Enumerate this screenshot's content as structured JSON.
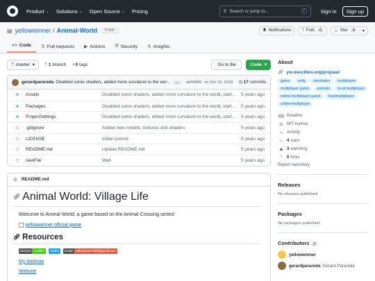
{
  "header": {
    "nav": [
      "Product",
      "Solutions",
      "Open Source",
      "Pricing"
    ],
    "search_placeholder": "Search or jump to...",
    "search_key": "/",
    "sign_in": "Sign in",
    "sign_up": "Sign up"
  },
  "repo": {
    "owner": "yellowwinner",
    "separator": "/",
    "name": "Animal-World",
    "visibility": "Public",
    "notifications_label": "Notifications",
    "fork_label": "Fork",
    "fork_count": "0",
    "star_label": "Star",
    "star_count": "4"
  },
  "tabs": [
    {
      "label": "Code",
      "icon": "code-icon"
    },
    {
      "label": "Pull requests",
      "icon": "pull-request-icon"
    },
    {
      "label": "Actions",
      "icon": "actions-icon"
    },
    {
      "label": "Security",
      "icon": "shield-icon"
    },
    {
      "label": "Insights",
      "icon": "graph-icon"
    }
  ],
  "toolbar": {
    "branch": "master",
    "branches_count": "1",
    "branches_label": "branch",
    "tags_count": "0",
    "tags_label": "tags",
    "go_to_file": "Go to file",
    "code_button": "Code"
  },
  "latest_commit": {
    "author": "gerardparareda",
    "message": "Disabled some shaders, added more curvature to the wor...",
    "ellipsis": "…",
    "sha": "a645846",
    "date": "on Oct 16, 2018",
    "commit_count": "17",
    "commits_label": "commits"
  },
  "files": [
    {
      "name": "Assets",
      "type": "folder",
      "message": "Disabled some shaders, added more curvature to the world, started...",
      "age": "5 years ago"
    },
    {
      "name": "Packages",
      "type": "folder",
      "message": "Disabled some shaders, added more curvature to the world, started...",
      "age": "5 years ago"
    },
    {
      "name": "ProjectSettings",
      "type": "folder",
      "message": "Disabled some shaders, added more curvature to the world, started...",
      "age": "5 years ago"
    },
    {
      "name": ".gitignore",
      "type": "file",
      "message": "Added new models, textures and shaders",
      "age": "5 years ago"
    },
    {
      "name": "LICENSE",
      "type": "file",
      "message": "Initial commit",
      "age": "5 years ago"
    },
    {
      "name": "README.md",
      "type": "file",
      "message": "Update README.md",
      "age": "5 years ago"
    },
    {
      "name": "newFile",
      "type": "file",
      "message": "Wah",
      "age": "5 years ago"
    }
  ],
  "readme": {
    "filename": "README.md",
    "title": "Animal World: Village Life",
    "intro": "Welcome to Animal World, a game based on the Animal Crossing series!",
    "image_alt": "yellowwinner official game",
    "resources_heading": "Resources",
    "shields": [
      {
        "left": "Discord",
        "right": "3 online",
        "left_color": "#555555",
        "right_color": "#4c1"
      },
      {
        "left": "Twitter",
        "right": "",
        "left_color": "#1da1f2",
        "right_color": "#1da1f2"
      },
      {
        "left": "Email",
        "right": "yellowwinner888@gmail.com",
        "left_color": "#555555",
        "right_color": "#e05d44"
      }
    ],
    "links": [
      "My Website",
      "Website"
    ]
  },
  "about": {
    "heading": "About",
    "website": "yw.neocities.org/proj/aw/",
    "topics": [
      "game",
      "unity",
      "simulation",
      "multiplayer",
      "multiplayer-game",
      "animals",
      "local-multiplayer",
      "online-multiplayer-game",
      "localmultiplayer",
      "online-multiplayer"
    ],
    "stats": [
      {
        "icon": "book-icon",
        "value": "",
        "label": "Readme"
      },
      {
        "icon": "law-icon",
        "value": "",
        "label": "MIT license"
      },
      {
        "icon": "pulse-icon",
        "value": "",
        "label": "Activity"
      },
      {
        "icon": "star-icon",
        "value": "4",
        "label": "stars"
      },
      {
        "icon": "eye-icon",
        "value": "3",
        "label": "watching"
      },
      {
        "icon": "fork-icon",
        "value": "0",
        "label": "forks"
      }
    ],
    "report": "Report repository"
  },
  "releases": {
    "heading": "Releases",
    "empty": "No releases published"
  },
  "packages": {
    "heading": "Packages",
    "empty": "No packages published"
  },
  "contributors": {
    "heading": "Contributors",
    "count": "2",
    "list": [
      {
        "login": "yellowwinner",
        "name": "",
        "avatar_color": "#f2c94c"
      },
      {
        "login": "gerardparareda",
        "name": "Gerard Parareda",
        "avatar_color": "#8a6d3b"
      }
    ]
  }
}
